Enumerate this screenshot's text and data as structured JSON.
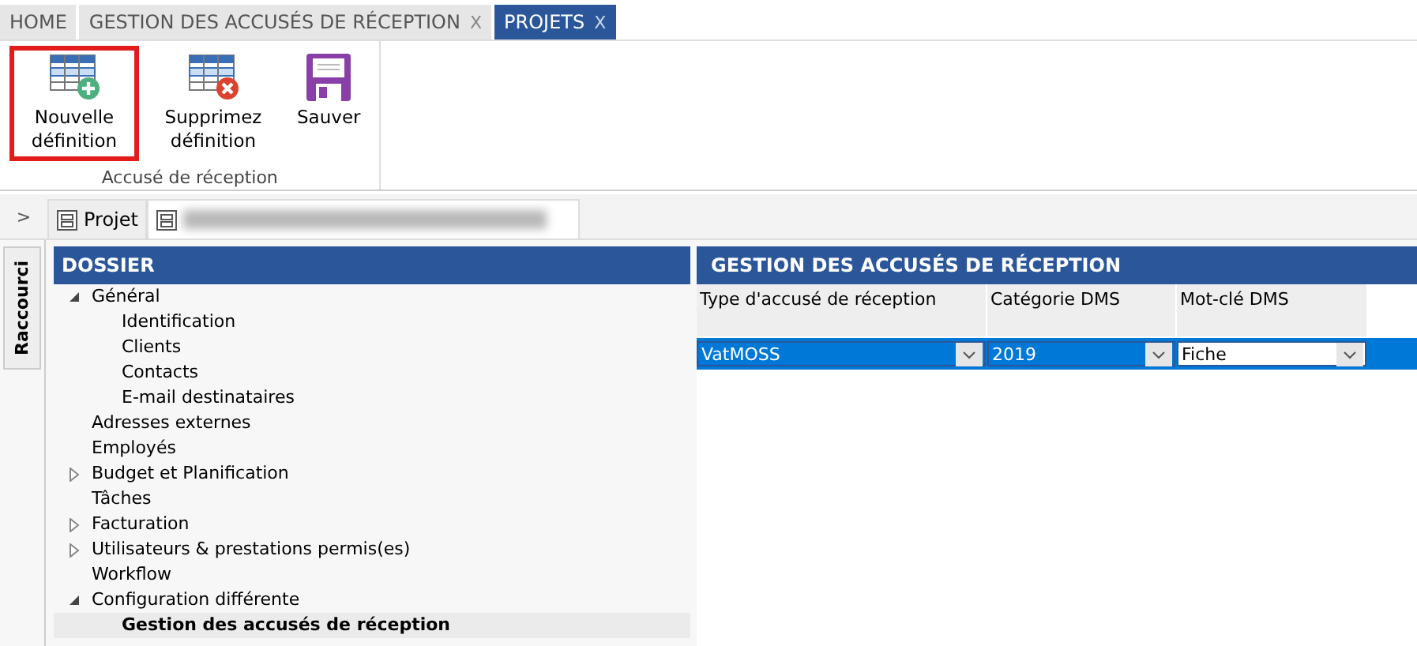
{
  "tabs": [
    {
      "label": "HOME",
      "selected": false
    },
    {
      "label": "GESTION DES ACCUSÉS DE RÉCEPTION",
      "selected": false,
      "close": "X"
    },
    {
      "label": "PROJETS",
      "selected": true,
      "close": "X"
    }
  ],
  "ribbon": {
    "group_label": "Accusé de réception",
    "buttons": [
      {
        "kind": "add",
        "label": "Nouvelle définition",
        "highlighted": true
      },
      {
        "kind": "delete",
        "label": "Supprimez définition",
        "highlighted": false
      },
      {
        "kind": "save",
        "label": "Sauver",
        "highlighted": false
      }
    ]
  },
  "shortcut_toggle": ">",
  "shortcut_label": "Raccourci",
  "doc_tabs": [
    {
      "label": "Projet",
      "selected": false,
      "redacted": false
    },
    {
      "selected": true,
      "redacted": true
    }
  ],
  "tree": {
    "title": "DOSSIER",
    "items": [
      {
        "label": "Général",
        "expanded": true,
        "selected": false,
        "children": [
          {
            "label": "Identification",
            "selected": false
          },
          {
            "label": "Clients",
            "selected": false
          },
          {
            "label": "Contacts",
            "selected": false
          },
          {
            "label": "E-mail destinataires",
            "selected": false
          }
        ]
      },
      {
        "label": "Adresses externes",
        "selected": false
      },
      {
        "label": "Employés",
        "selected": false
      },
      {
        "label": "Budget et Planification",
        "expanded": false,
        "selected": false
      },
      {
        "label": "Tâches",
        "selected": false
      },
      {
        "label": "Facturation",
        "expanded": false,
        "selected": false
      },
      {
        "label": "Utilisateurs & prestations permis(es)",
        "expanded": false,
        "selected": false
      },
      {
        "label": "Workflow",
        "selected": false
      },
      {
        "label": "Configuration différente",
        "expanded": true,
        "selected": false,
        "children": [
          {
            "label": "Gestion des accusés de réception",
            "selected": true
          }
        ]
      }
    ]
  },
  "grid": {
    "title": "GESTION DES ACCUSÉS DE RÉCEPTION",
    "columns": [
      "Type d'accusé de réception",
      "Catégorie DMS",
      "Mot-clé DMS"
    ],
    "rows": [
      {
        "selected": true,
        "cells": [
          {
            "value": "VatMOSS",
            "focused": false
          },
          {
            "value": "2019",
            "focused": false
          },
          {
            "value": "Fiche",
            "focused": true
          }
        ]
      }
    ]
  }
}
